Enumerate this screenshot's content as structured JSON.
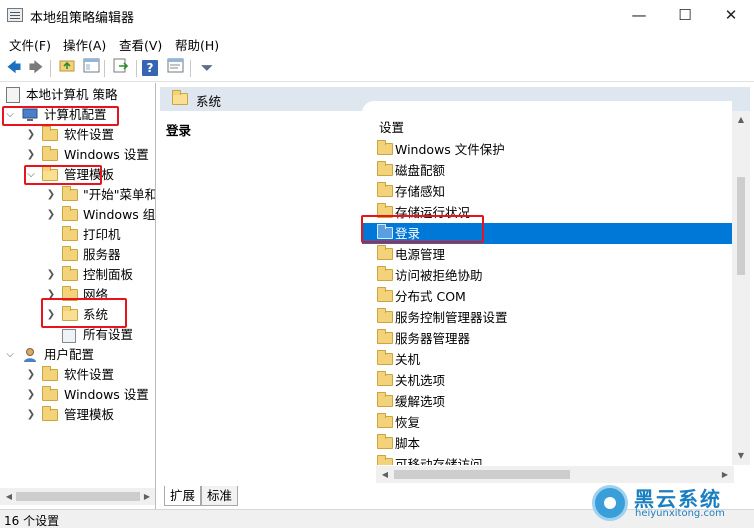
{
  "window": {
    "title": "本地组策略编辑器",
    "min": "—",
    "max": "☐",
    "close": "✕"
  },
  "menu": [
    "文件(F)",
    "操作(A)",
    "查看(V)",
    "帮助(H)"
  ],
  "toolbar": {
    "back": "🡄",
    "forward": "🡆",
    "help": "?",
    "filter": "⏷"
  },
  "tree": {
    "root": "本地计算机 策略",
    "computer_config": "计算机配置",
    "software_settings": "软件设置",
    "windows_settings": "Windows 设置",
    "admin_templates": "管理模板",
    "start_menu": "\"开始\"菜单和",
    "windows_components": "Windows 组件",
    "printers": "打印机",
    "servers": "服务器",
    "control_panel": "控制面板",
    "network": "网络",
    "system": "系统",
    "all_settings": "所有设置",
    "user_config": "用户配置",
    "user_software": "软件设置",
    "user_windows": "Windows 设置",
    "user_admin": "管理模板"
  },
  "right": {
    "header": "系统",
    "desc_title": "登录",
    "column": "设置",
    "items": [
      "Windows 文件保护",
      "磁盘配额",
      "存储感知",
      "存储运行状况",
      "登录",
      "电源管理",
      "访问被拒绝协助",
      "分布式 COM",
      "服务控制管理器设置",
      "服务器管理器",
      "关机",
      "关机选项",
      "缓解选项",
      "恢复",
      "脚本",
      "可移动存储访问"
    ],
    "selected_index": 4
  },
  "tabs": {
    "extended": "扩展",
    "standard": "标准"
  },
  "status": "16 个设置",
  "watermark": {
    "brand": "黑云系统",
    "url": "heiyunxitong.com"
  }
}
